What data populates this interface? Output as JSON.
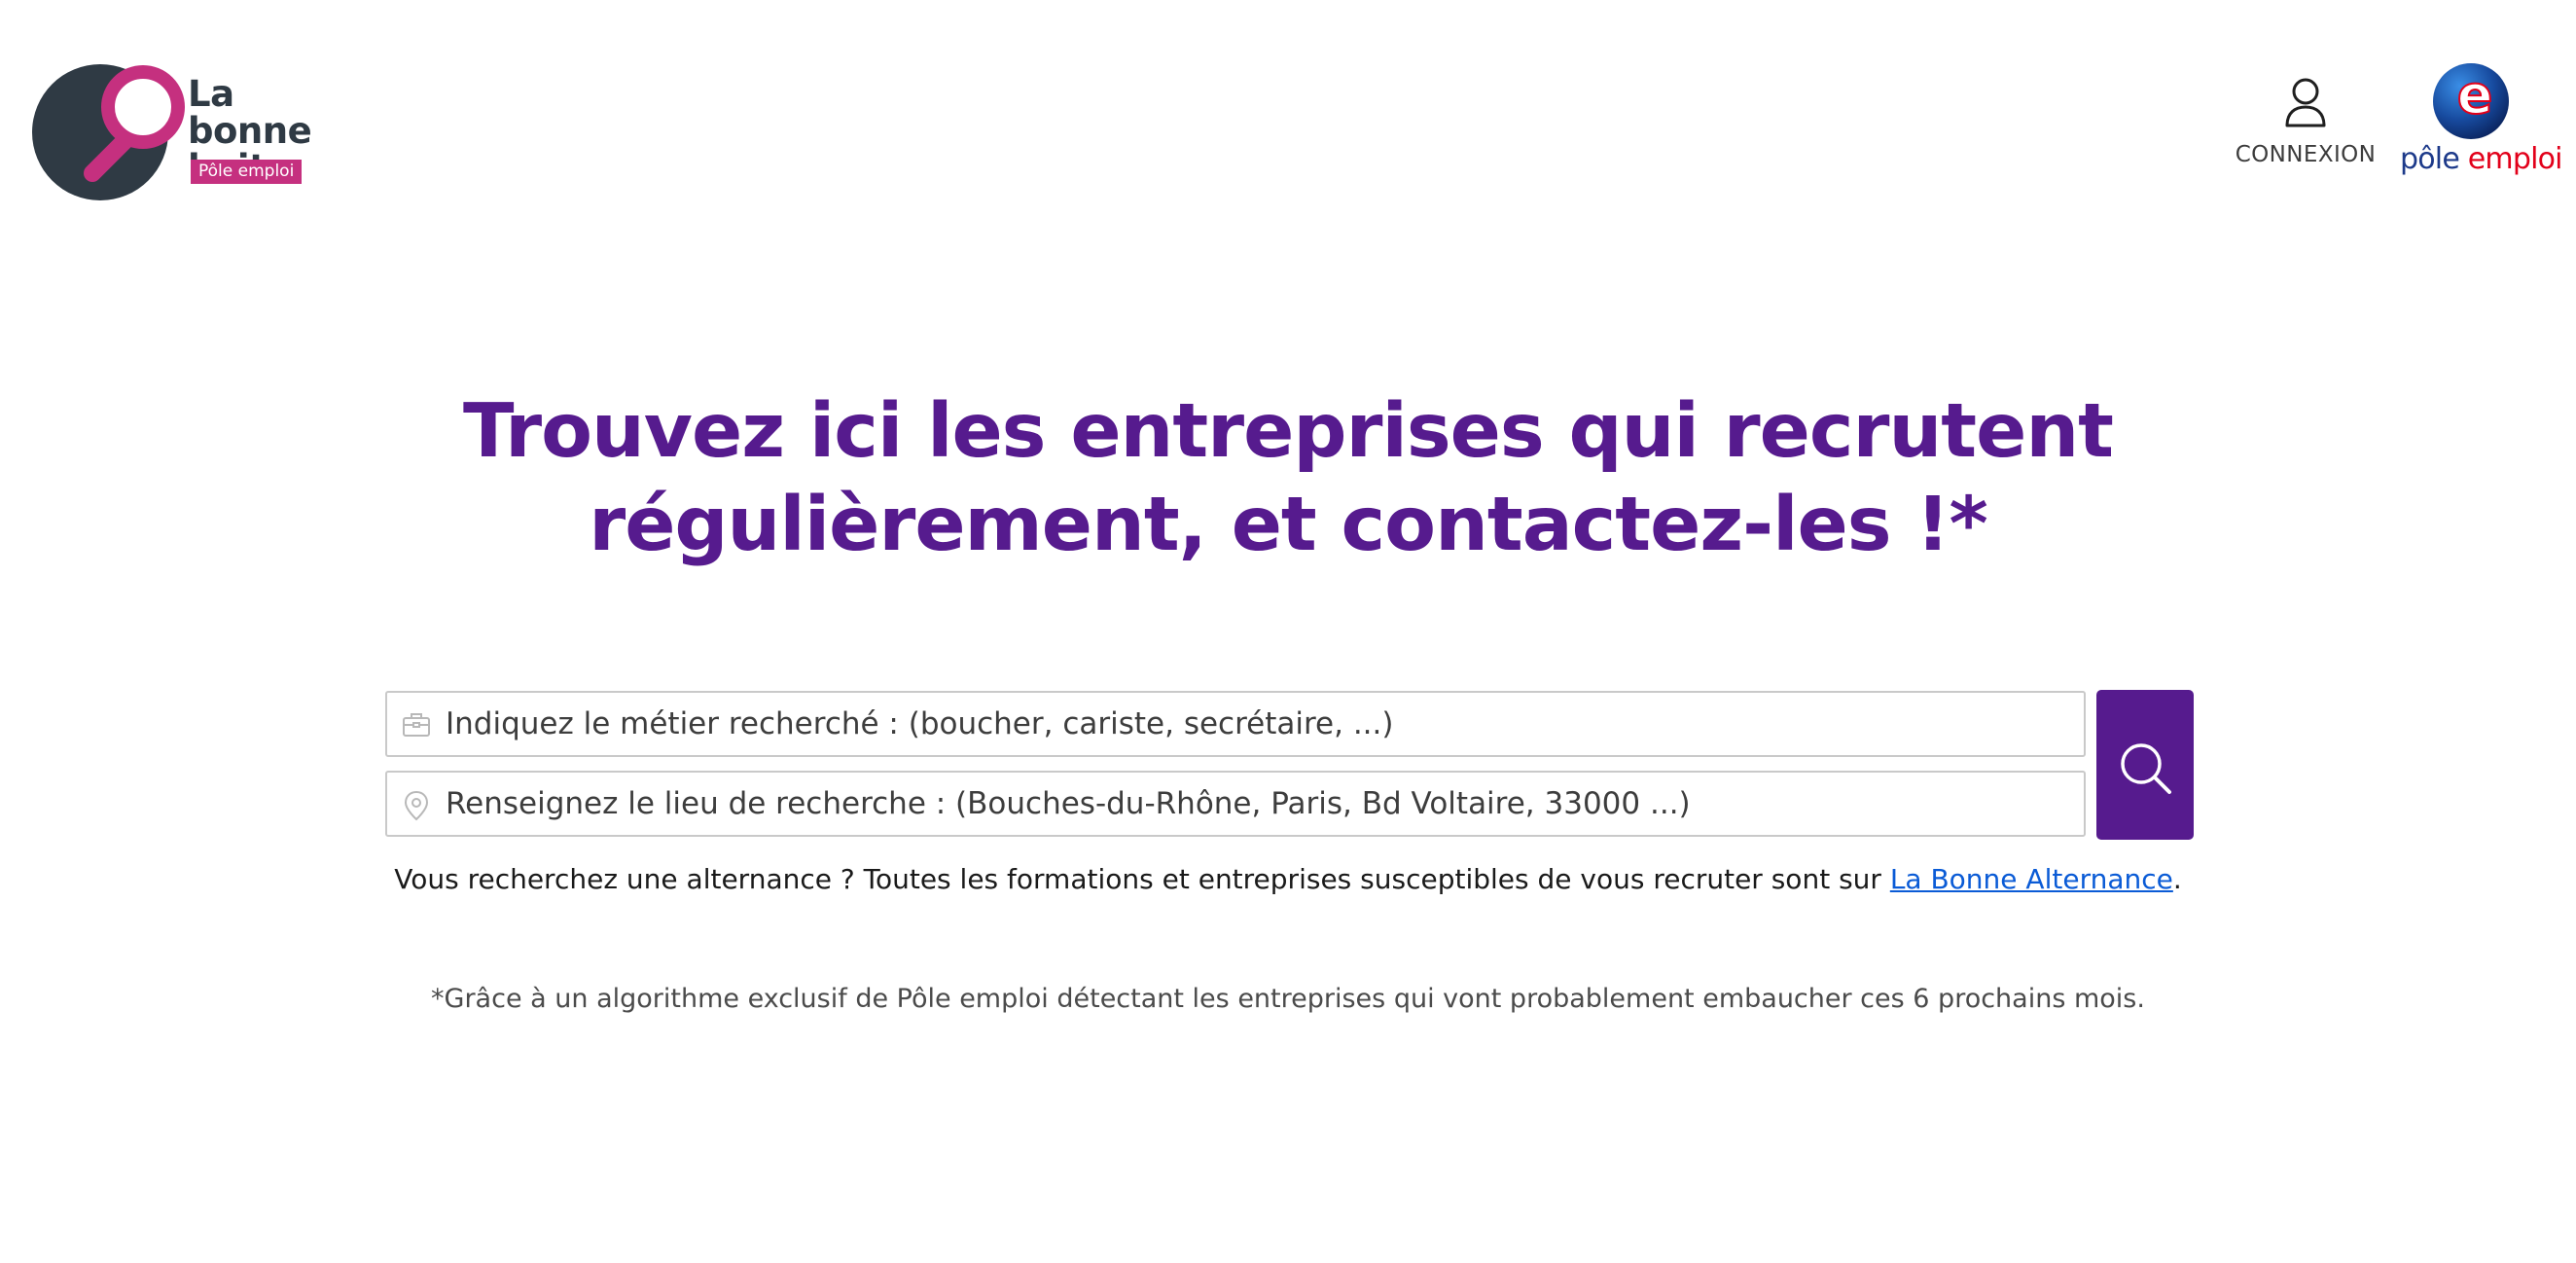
{
  "header": {
    "logo": {
      "line1": "La bonne",
      "line2": "boite",
      "badge": "Pôle emploi",
      "icon": "magnifier-logo-icon"
    },
    "connexion": {
      "label": "CONNEXION",
      "icon": "user-icon"
    },
    "pole_emploi_logo": {
      "part1": "pôle",
      "part2": "emploi",
      "icon": "pole-emploi-e-icon"
    }
  },
  "headline": {
    "line1": "Trouvez ici les entreprises qui recrutent",
    "line2": "régulièrement, et contactez-les !*"
  },
  "search": {
    "job_placeholder": "Indiquez le métier recherché : (boucher, cariste, secrétaire, ...)",
    "place_placeholder": "Renseignez le lieu de recherche : (Bouches-du-Rhône, Paris, Bd Voltaire, 33000 ...)",
    "job_icon": "briefcase-icon",
    "place_icon": "location-pin-icon",
    "button_icon": "search-icon"
  },
  "alternance": {
    "text": "Vous recherchez une alternance ? Toutes les formations et entreprises susceptibles de vous recruter sont sur ",
    "link": "La Bonne Alternance",
    "suffix": "."
  },
  "footnote": "*Grâce à un algorithme exclusif de Pôle emploi détectant les entreprises qui vont probablement embaucher ces 6 prochains mois.",
  "colors": {
    "brand_purple": "#561b8e",
    "logo_pink": "#c5307f",
    "logo_dark": "#2f3a44",
    "link_blue": "#0a5bd6",
    "pe_blue": "#1d3a8a",
    "pe_red": "#e2001a"
  }
}
